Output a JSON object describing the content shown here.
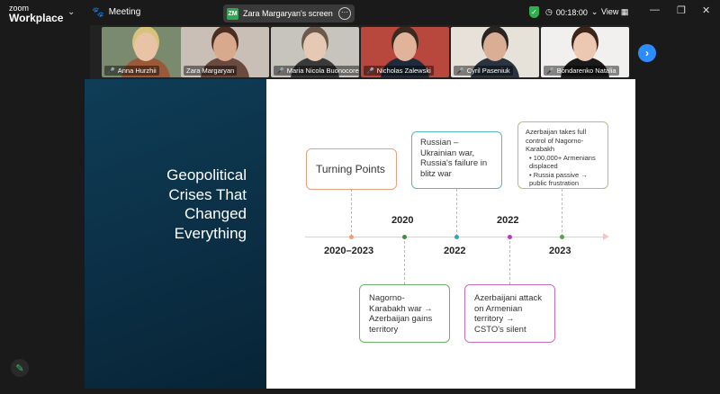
{
  "app": {
    "logo_line1": "zoom",
    "logo_line2": "Workplace",
    "menu_chevron": "⌄",
    "meeting_label": "Meeting",
    "paw_icon": "🐾"
  },
  "share": {
    "initials": "ZM",
    "label": "Zara Margaryan's screen",
    "more": "···"
  },
  "status": {
    "shield": "✓",
    "timer": "00:18:00",
    "timer_chev": "⌄",
    "view_label": "View"
  },
  "window": {
    "minimize": "—",
    "restore": "❐",
    "close": "✕"
  },
  "participants": [
    {
      "name": "Anna Hurzhii",
      "bg": "#7a8a6e",
      "skin": "#e8c3a5",
      "hair": "#d9c27a",
      "shirt": "#9a5a3a"
    },
    {
      "name": "Zara Margaryan",
      "bg": "#c9bfb6",
      "skin": "#d8a98c",
      "hair": "#4a2e22",
      "shirt": "#6a4a3f"
    },
    {
      "name": "Maria Nicola Buonocore",
      "bg": "#c7c3bd",
      "skin": "#e6c9b4",
      "hair": "#6b5a4b",
      "shirt": "#3a3a3a"
    },
    {
      "name": "Nicholas Zalewski",
      "bg": "#b8473e",
      "skin": "#e0b39a",
      "hair": "#3a2a1f",
      "shirt": "#1f2b3a"
    },
    {
      "name": "Cyril Paseniuk",
      "bg": "#e6e2da",
      "skin": "#d9ae94",
      "hair": "#2a2420",
      "shirt": "#2a3340"
    },
    {
      "name": "Bondarenko Natalia",
      "bg": "#f2f0ee",
      "skin": "#ecc8b3",
      "hair": "#3b2418",
      "shirt": "#1a1a1a"
    }
  ],
  "next_arrow": "›",
  "slide": {
    "title_lines": [
      "Geopolitical",
      "Crises That",
      "Changed",
      "Everything"
    ],
    "turning_points": "Turning Points",
    "upper": [
      {
        "text": "Russian – Ukrainian war, Russia's failure in blitz war",
        "color": "#5bb5c8"
      },
      {
        "heading": "Azerbaijan takes full control of Nagorno-Karabakh",
        "bullets": [
          "100,000+ Armenians displaced",
          "Russia passive → public frustration"
        ],
        "color": "#a6c77a"
      }
    ],
    "lower": [
      {
        "text": "Nagorno-Karabakh war → Azerbaijan gains territory",
        "color": "#6bb36b"
      },
      {
        "text": "Azerbaijani attack on Armenian territory → CSTO's silent",
        "color": "#c86ac8"
      }
    ],
    "years_above": [
      "2020",
      "2022"
    ],
    "years_below": [
      "2020–2023",
      "2022",
      "2023"
    ],
    "tp_color": "#e9a07a",
    "dot_colors": [
      "#e9a07a",
      "#3f8f3f",
      "#2aa7c4",
      "#b63cb6",
      "#5aa04a"
    ]
  },
  "edit_icon": "✎"
}
